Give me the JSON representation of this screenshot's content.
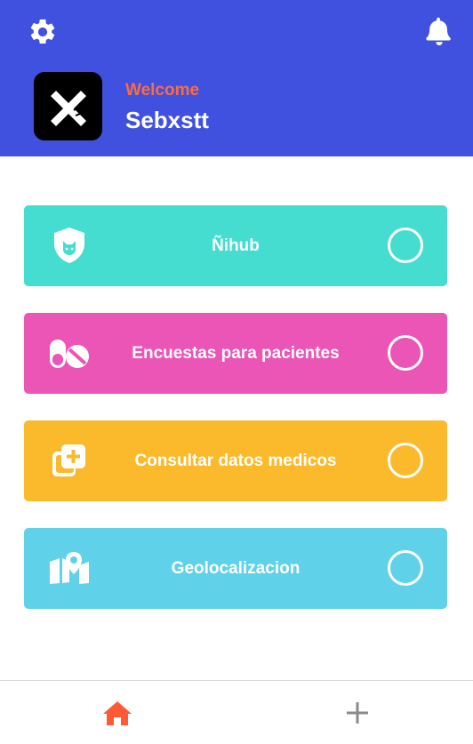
{
  "header": {
    "welcome": "Welcome",
    "username": "Sebxstt",
    "icons": {
      "settings": "gear-icon",
      "notifications": "bell-icon",
      "avatar": "x-logo"
    },
    "background": "#3f51de",
    "welcome_color": "#ff6b3d"
  },
  "menu": [
    {
      "label": "Ñihub",
      "icon": "shield-cat-icon",
      "color": "#45ddd0"
    },
    {
      "label": "Encuestas para pacientes",
      "icon": "pills-icon",
      "color": "#ea55b6"
    },
    {
      "label": "Consultar datos medicos",
      "icon": "medical-records-icon",
      "color": "#fbba2b"
    },
    {
      "label": "Geolocalizacion",
      "icon": "map-icon",
      "color": "#5fd2ea"
    }
  ],
  "bottom_nav": [
    {
      "name": "home",
      "icon": "home-icon",
      "active": true,
      "color": "#ff5a36"
    },
    {
      "name": "add",
      "icon": "plus-icon",
      "active": false,
      "color": "#8a8a8a"
    }
  ]
}
